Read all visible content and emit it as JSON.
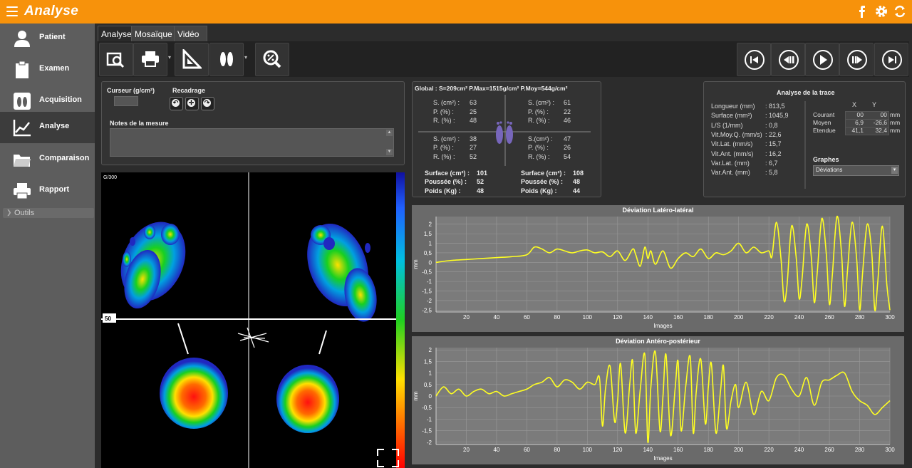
{
  "app": {
    "title": "Analyse"
  },
  "sidebar": {
    "items": [
      {
        "label": "Patient"
      },
      {
        "label": "Examen"
      },
      {
        "label": "Acquisition"
      },
      {
        "label": "Analyse"
      },
      {
        "label": "Comparaison"
      },
      {
        "label": "Rapport"
      }
    ],
    "tools_label": "Outils"
  },
  "tabs": [
    {
      "label": "Analyse"
    },
    {
      "label": "Mosaïque"
    },
    {
      "label": "Vidéo"
    }
  ],
  "cursor_panel": {
    "cursor_label": "Curseur (g/cm²)",
    "recadrage_label": "Recadrage",
    "notes_label": "Notes de la mesure"
  },
  "global_stats": {
    "header": "Global : S=209cm²  P.Max=1515g/cm²  P.Moy=544g/cm²",
    "quadrants": [
      {
        "s_label": "S. (cm²) :",
        "s": "63",
        "p_label": "P. (%) :",
        "p": "25",
        "r_label": "R. (%) :",
        "r": "48"
      },
      {
        "s_label": "S. (cm²) :",
        "s": "61",
        "p_label": "P. (%) :",
        "p": "22",
        "r_label": "R. (%) :",
        "r": "46"
      },
      {
        "s_label": "S. (cm²) :",
        "s": "38",
        "p_label": "P. (%) :",
        "p": "27",
        "r_label": "R. (%) :",
        "r": "52"
      },
      {
        "s_label": "S.(cm²) :",
        "s": "47",
        "p_label": "P. (%) :",
        "p": "26",
        "r_label": "R. (%) :",
        "r": "54"
      }
    ],
    "left_totals": {
      "surface_label": "Surface (cm²) :",
      "surface": "101",
      "poussee_label": "Poussée (%) :",
      "poussee": "52",
      "poids_label": "Poids (Kg) :",
      "poids": "48"
    },
    "right_totals": {
      "surface_label": "Surface (cm²) :",
      "surface": "108",
      "poussee_label": "Poussée (%) :",
      "poussee": "48",
      "poids_label": "Poids (Kg) :",
      "poids": "44"
    }
  },
  "trace": {
    "title": "Analyse de la trace",
    "rows": [
      {
        "label": "Longueur (mm)",
        "value": ": 813,5"
      },
      {
        "label": "Surface (mm²)",
        "value": ": 1045,9"
      },
      {
        "label": "L/S (1/mm)",
        "value": ": 0,8"
      },
      {
        "label": "Vit.Moy.Q. (mm/s)",
        "value": ": 22,6"
      },
      {
        "label": "Vit.Lat. (mm/s)",
        "value": ": 15,7"
      },
      {
        "label": "Vit.Ant. (mm/s)",
        "value": ": 16,2"
      },
      {
        "label": "Var.Lat. (mm)",
        "value": ": 6,7"
      },
      {
        "label": "Var.Ant. (mm)",
        "value": ": 5,8"
      }
    ],
    "xy_header_x": "X",
    "xy_header_y": "Y",
    "xy_rows": [
      {
        "label": "Courant",
        "x": "00",
        "y": "00",
        "unit": "mm"
      },
      {
        "label": "Moyen",
        "x": "6,9",
        "y": "-26,6",
        "unit": "mm"
      },
      {
        "label": "Etendue",
        "x": "41,1",
        "y": "32,4",
        "unit": "mm"
      }
    ],
    "graphs_label": "Graphes",
    "graphs_selected": "Déviations"
  },
  "image": {
    "scale_label": "G/300",
    "cursor_value": "50"
  },
  "chart_data": [
    {
      "type": "line",
      "title": "Déviation Latéro-latéral",
      "xlabel": "Images",
      "ylabel": "mm",
      "xlim": [
        0,
        300
      ],
      "ylim": [
        -2.6,
        2.4
      ],
      "x_ticks": [
        "20",
        "40",
        "60",
        "80",
        "100",
        "120",
        "140",
        "160",
        "180",
        "200",
        "220",
        "240",
        "260",
        "280",
        "300"
      ],
      "y_ticks": [
        "2",
        "1,5",
        "1",
        "0,5",
        "0",
        "-0,5",
        "-1",
        "-1,5",
        "-2",
        "-2,5"
      ],
      "series": [
        {
          "color": "#ffff22",
          "x": [
            0,
            10,
            20,
            30,
            40,
            50,
            60,
            65,
            70,
            75,
            80,
            85,
            90,
            95,
            100,
            105,
            110,
            115,
            120,
            125,
            130,
            132,
            135,
            138,
            140,
            142,
            145,
            150,
            155,
            160,
            165,
            170,
            175,
            180,
            185,
            190,
            195,
            200,
            205,
            210,
            215,
            220,
            222,
            225,
            228,
            230,
            232,
            235,
            238,
            240,
            242,
            245,
            248,
            250,
            252,
            255,
            258,
            260,
            262,
            265,
            268,
            270,
            272,
            275,
            278,
            280,
            282,
            285,
            288,
            290,
            292,
            295,
            298,
            300
          ],
          "y": [
            0,
            0.1,
            0.15,
            0.2,
            0.25,
            0.3,
            0.4,
            0.8,
            0.7,
            0.5,
            0.7,
            0.6,
            0.5,
            0.6,
            0.65,
            0.5,
            0.55,
            0.3,
            0.6,
            0.1,
            0.7,
            0.4,
            -0.2,
            0.8,
            0.2,
            0.6,
            -0.1,
            0.6,
            -0.3,
            0.2,
            0.5,
            0.3,
            0.7,
            0.2,
            0.5,
            0.4,
            0.6,
            1.0,
            0.5,
            0.8,
            0.5,
            0.6,
            0.3,
            2.1,
            0.2,
            -2.0,
            -1.2,
            1.9,
            0.3,
            -1.9,
            -0.8,
            2.0,
            0.3,
            -2.1,
            -0.5,
            2.3,
            0.4,
            -2.2,
            -0.6,
            2.4,
            0.5,
            -2.3,
            -0.4,
            2.1,
            0.2,
            -2.5,
            -0.5,
            2.0,
            0.5,
            -2.5,
            -1.0,
            1.9,
            -1.2,
            -2.5
          ]
        }
      ]
    },
    {
      "type": "line",
      "title": "Déviation Antéro-postérieur",
      "xlabel": "Images",
      "ylabel": "mm",
      "xlim": [
        0,
        300
      ],
      "ylim": [
        -2.1,
        2.1
      ],
      "x_ticks": [
        "20",
        "40",
        "60",
        "80",
        "100",
        "120",
        "140",
        "160",
        "180",
        "200",
        "220",
        "240",
        "260",
        "280",
        "300"
      ],
      "y_ticks": [
        "2",
        "1,5",
        "1",
        "0,5",
        "0",
        "-0,5",
        "-1",
        "-1,5",
        "-2"
      ],
      "series": [
        {
          "color": "#ffff22",
          "x": [
            0,
            5,
            10,
            15,
            20,
            25,
            30,
            35,
            40,
            45,
            50,
            55,
            60,
            65,
            70,
            75,
            80,
            85,
            90,
            95,
            100,
            105,
            108,
            110,
            112,
            115,
            118,
            120,
            122,
            125,
            128,
            130,
            132,
            135,
            138,
            140,
            142,
            145,
            148,
            150,
            152,
            155,
            158,
            160,
            162,
            165,
            168,
            170,
            172,
            175,
            178,
            180,
            182,
            185,
            188,
            190,
            192,
            195,
            198,
            200,
            205,
            210,
            215,
            220,
            225,
            230,
            235,
            240,
            245,
            250,
            255,
            260,
            265,
            270,
            275,
            280,
            285,
            290,
            295,
            300
          ],
          "y": [
            0,
            0.4,
            0.1,
            0.3,
            0,
            0.2,
            0.3,
            0.1,
            0.2,
            0,
            0.1,
            0.2,
            0.3,
            0.5,
            0.6,
            0.8,
            0.4,
            0.7,
            0.6,
            0.3,
            0.6,
            0.5,
            0.8,
            -1.3,
            0.3,
            1.3,
            -1.1,
            -0.2,
            1.4,
            -1.6,
            0.5,
            1.5,
            -1.6,
            0.3,
            1.8,
            -2.0,
            0.4,
            1.9,
            -1.5,
            0,
            1.8,
            -1.7,
            0.3,
            1.5,
            -1.5,
            0.4,
            1.7,
            -1.6,
            0.2,
            1.6,
            -1.2,
            0.4,
            1.4,
            -1.6,
            0.2,
            1.3,
            -1.4,
            -0.2,
            0.5,
            -0.5,
            0.6,
            -0.8,
            0.2,
            -0.2,
            0.8,
            0.9,
            0.3,
            0,
            0.8,
            -0.4,
            0.6,
            0.7,
            0.9,
            1.0,
            0.2,
            -0.2,
            -0.4,
            -0.8,
            -0.5,
            -0.2
          ]
        }
      ]
    }
  ]
}
